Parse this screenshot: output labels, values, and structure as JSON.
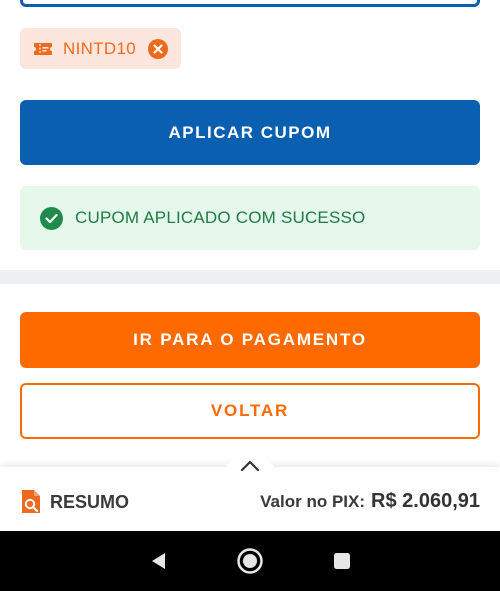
{
  "coupon": {
    "code": "NINTD10",
    "icon": "ticket-icon",
    "remove_icon": "close-circle-icon"
  },
  "apply_button": {
    "label": "APLICAR CUPOM"
  },
  "success": {
    "message": "CUPOM APLICADO COM SUCESSO",
    "icon": "check-circle-icon"
  },
  "actions": {
    "pay_label": "IR PARA O PAGAMENTO",
    "back_label": "VOLTAR"
  },
  "summary": {
    "label": "RESUMO",
    "icon": "document-search-icon",
    "toggle_icon": "chevron-up-icon",
    "pix_label": "Valor no PIX:",
    "pix_value": "R$ 2.060,91"
  },
  "navigation": {
    "back_icon": "nav-back-icon",
    "home_icon": "nav-home-icon",
    "recents_icon": "nav-recents-icon"
  },
  "colors": {
    "primary_blue": "#0b5fb0",
    "accent_orange": "#ff6a00",
    "success_green": "#1f8a4c",
    "chip_bg": "#fde6dd"
  }
}
